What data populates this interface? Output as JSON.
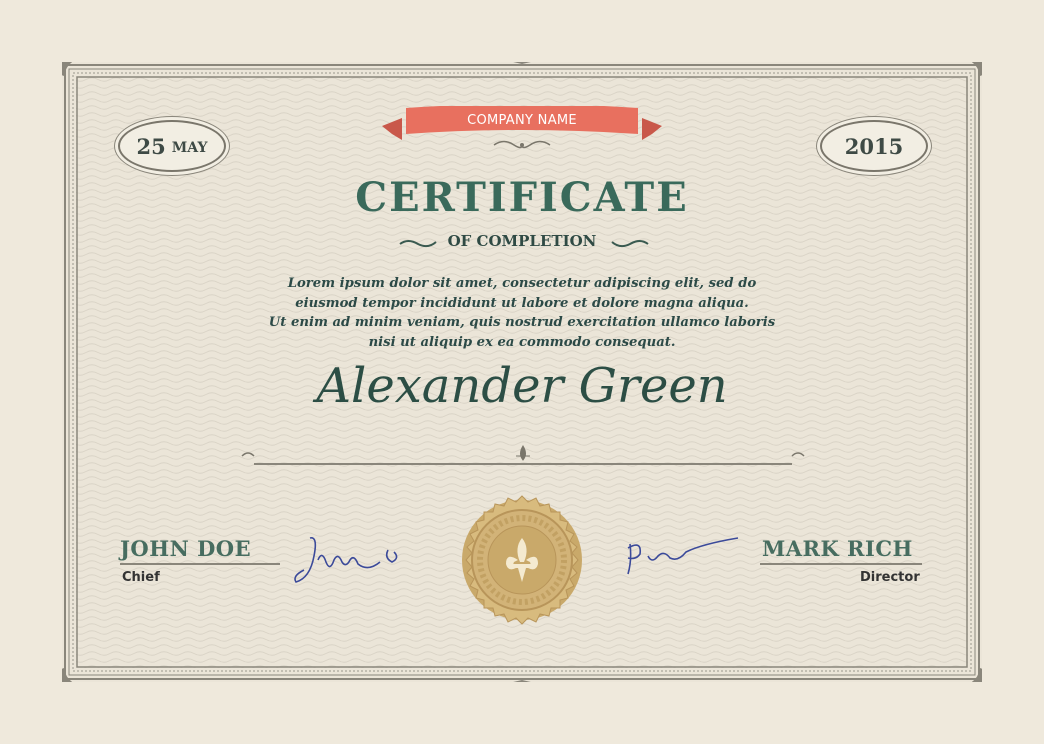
{
  "certificate": {
    "date": {
      "day": "25",
      "month": "MAY",
      "year": "2015"
    },
    "company_name": "COMPANY NAME",
    "title": "CERTIFICATE",
    "subtitle": "OF COMPLETION",
    "body_lines": [
      "Lorem ipsum dolor sit amet, consectetur adipiscing elit, sed do",
      "eiusmod tempor incididunt ut labore et dolore magna aliqua.",
      "Ut enim ad minim veniam, quis nostrud exercitation ullamco laboris",
      "nisi ut aliquip ex ea commodo consequat."
    ],
    "recipient": "Alexander Green",
    "signatories": {
      "left": {
        "name": "JOHN DOE",
        "role": "Chief"
      },
      "right": {
        "name": "MARK RICH",
        "role": "Director"
      }
    },
    "seal_icon": "fleur-de-lis-icon",
    "colors": {
      "background": "#efe9dc",
      "frame": "#8a867b",
      "ribbon": "#e8705f",
      "title": "#3a6a5b",
      "text": "#2c4a47",
      "seal": "#c9a96a",
      "signature_ink": "#3b4a9a"
    }
  }
}
